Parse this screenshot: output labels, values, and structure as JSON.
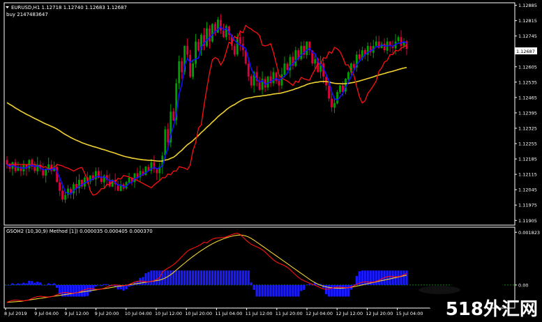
{
  "main_title": "EURUSD,H1  1.12718 1.12740 1.12683 1.12687",
  "subtitle": "buy 2147483647",
  "osc_title": "GSOH2 (10,30,9) Method [1]) 0.000035 0.000405 0.000370",
  "watermark": "518外汇网",
  "current_price": "1.12687",
  "colors": {
    "background": "#000000",
    "bull_candle": "#00a000",
    "bear_candle": "#e0003c",
    "blue_line": "#1010ff",
    "red_line": "#ff1010",
    "yellow_line": "#f2d230",
    "histogram": "#1a1aff",
    "zero_line": "#0a8a0a",
    "frame": "#ffffff",
    "price_tag_bg": "#ffffff",
    "price_tag_text": "#000000"
  },
  "chart_data": [
    {
      "type": "candlestick",
      "title": "EURUSD,H1",
      "y_ticks": [
        "1.12885",
        "1.12815",
        "1.12745",
        "1.12675",
        "1.12605",
        "1.12535",
        "1.12465",
        "1.12395",
        "1.12325",
        "1.12255",
        "1.12185",
        "1.12115",
        "1.12045",
        "1.11975",
        "1.11905"
      ],
      "y_tick_values": [
        1.12885,
        1.12815,
        1.12745,
        1.12675,
        1.12605,
        1.12535,
        1.12465,
        1.12395,
        1.12325,
        1.12255,
        1.12185,
        1.12115,
        1.12045,
        1.11975,
        1.11905
      ],
      "ylim": [
        1.1189,
        1.1289
      ],
      "last_price": 1.12687,
      "x_ticks": [
        "8 Jul 2019",
        "9 Jul 04:00",
        "9 Jul 12:00",
        "9 Jul 20:00",
        "10 Jul 04:00",
        "10 Jul 12:00",
        "10 Jul 20:00",
        "11 Jul 04:00",
        "11 Jul 12:00",
        "11 Jul 20:00",
        "12 Jul 04:00",
        "12 Jul 12:00",
        "12 Jul 20:00",
        "15 Jul 04:00"
      ],
      "candle_count": 145,
      "closes": [
        1.1216,
        1.1214,
        1.1217,
        1.1213,
        1.1215,
        1.1213,
        1.1216,
        1.1214,
        1.1218,
        1.1215,
        1.1213,
        1.1216,
        1.1214,
        1.1211,
        1.1214,
        1.1216,
        1.1213,
        1.1215,
        1.1208,
        1.1204,
        1.12,
        1.1202,
        1.1205,
        1.1203,
        1.1207,
        1.1205,
        1.1209,
        1.1206,
        1.121,
        1.1208,
        1.1211,
        1.1209,
        1.1213,
        1.121,
        1.1208,
        1.1211,
        1.1209,
        1.1206,
        1.1209,
        1.1207,
        1.1204,
        1.1207,
        1.1205,
        1.1208,
        1.121,
        1.1208,
        1.1212,
        1.121,
        1.1213,
        1.1211,
        1.1215,
        1.1213,
        1.1217,
        1.1214,
        1.1212,
        1.1215,
        1.122,
        1.1232,
        1.1226,
        1.124,
        1.1236,
        1.1253,
        1.1263,
        1.1258,
        1.127,
        1.1266,
        1.1256,
        1.1262,
        1.1272,
        1.1268,
        1.1275,
        1.127,
        1.1278,
        1.1272,
        1.128,
        1.1276,
        1.1282,
        1.1277,
        1.1274,
        1.1279,
        1.1275,
        1.127,
        1.1266,
        1.1274,
        1.1271,
        1.1268,
        1.1262,
        1.1256,
        1.1252,
        1.1258,
        1.1254,
        1.125,
        1.1255,
        1.1251,
        1.1256,
        1.1253,
        1.1258,
        1.1254,
        1.1252,
        1.1257,
        1.1262,
        1.1259,
        1.1265,
        1.1261,
        1.1268,
        1.1264,
        1.127,
        1.1266,
        1.1272,
        1.1268,
        1.1262,
        1.1264,
        1.1258,
        1.1262,
        1.1256,
        1.1252,
        1.1246,
        1.1242,
        1.1244,
        1.1249,
        1.1252,
        1.1249,
        1.1255,
        1.1258,
        1.1262,
        1.126,
        1.1266,
        1.1264,
        1.1268,
        1.1266,
        1.127,
        1.1267,
        1.127,
        1.1272,
        1.1269,
        1.1271,
        1.1268,
        1.1272,
        1.127,
        1.1269,
        1.1272,
        1.1274,
        1.127,
        1.1272,
        1.12687
      ]
    },
    {
      "type": "oscillator",
      "title": "GSOH2 (10,30,9)",
      "y_ticks": [
        "0.001823",
        "0.00"
      ],
      "y_tick_values": [
        0.001823,
        0.0
      ],
      "ylim": [
        -0.00075,
        0.00195
      ],
      "values": {
        "histogram": 3.5e-05,
        "line_1": 0.000405,
        "line_2": 0.00037
      }
    }
  ]
}
